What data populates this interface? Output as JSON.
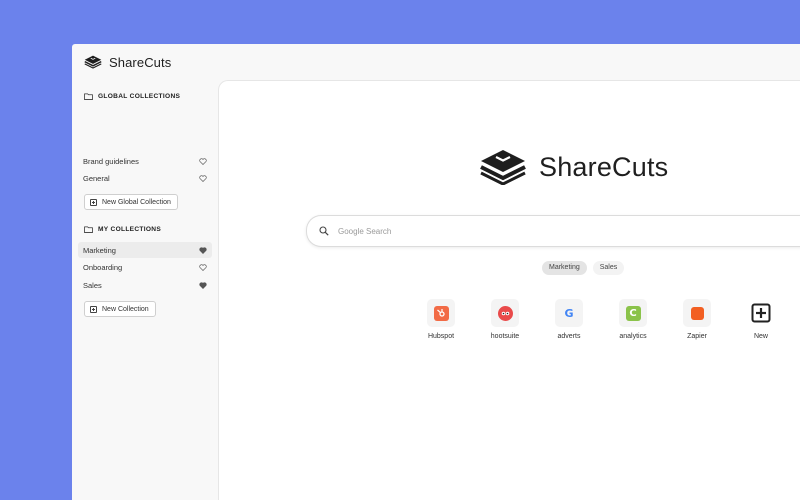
{
  "app": {
    "name": "ShareCuts"
  },
  "sidebar": {
    "global_header": "GLOBAL COLLECTIONS",
    "global_items": [
      {
        "label": "Brand guidelines",
        "heart": "outline"
      },
      {
        "label": "General",
        "heart": "outline"
      }
    ],
    "new_global_label": "New Global Collection",
    "my_header": "MY COLLECTIONS",
    "my_items": [
      {
        "label": "Marketing",
        "heart": "filled",
        "active": true
      },
      {
        "label": "Onboarding",
        "heart": "outline"
      },
      {
        "label": "Sales",
        "heart": "filled"
      }
    ],
    "new_collection_label": "New Collection"
  },
  "main": {
    "brand": "ShareCuts",
    "search_placeholder": "Google Search",
    "tabs": [
      {
        "label": "Marketing",
        "active": true
      },
      {
        "label": "Sales",
        "active": false
      }
    ],
    "shortcuts": [
      {
        "label": "Hubspot",
        "icon": "hubspot-icon",
        "color": "#f26b46"
      },
      {
        "label": "hootsuite",
        "icon": "hootsuite-icon",
        "color": "#e94a4a"
      },
      {
        "label": "adverts",
        "icon": "google-icon",
        "color": "#4285f4"
      },
      {
        "label": "analytics",
        "icon": "analytics-icon",
        "color": "#8bc34a"
      },
      {
        "label": "Zapier",
        "icon": "zapier-icon",
        "color": "#f25f22"
      },
      {
        "label": "New",
        "icon": "add-icon",
        "color": "#222222"
      }
    ]
  },
  "colors": {
    "background": "#6b82ec",
    "accent": "#222222"
  }
}
